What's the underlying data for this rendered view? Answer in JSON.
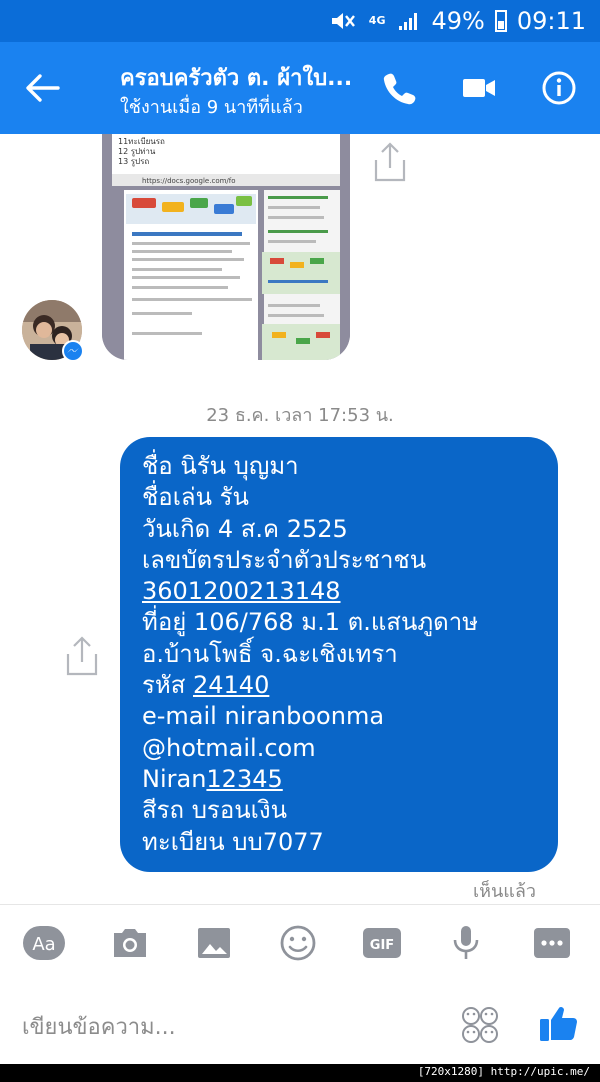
{
  "status": {
    "network": "4G",
    "battery": "49%",
    "time": "09:11"
  },
  "header": {
    "title": "ครอบครัวตัว ต. ผ้าใบ...",
    "subtitle": "ใช้งานเมื่อ 9 นาทีที่แล้ว",
    "icons": [
      "back-arrow-icon",
      "phone-icon",
      "video-camera-icon",
      "info-icon"
    ]
  },
  "shared_image": {
    "lines": [
      "11ทะเบียนรถ",
      "12 รูปท่าน",
      "13 รูปรถ"
    ],
    "url": "https://docs.google.com/fo"
  },
  "timestamp": "23 ธ.ค. เวลา 17:53 น.",
  "message": {
    "line1": "ชื่อ นิรัน บุญมา",
    "line2": "ชื่อเล่น รัน",
    "line3": "วันเกิด 4 ส.ค 2525",
    "line4": "เลขบัตรประจำตัวประชาชน",
    "line5": "3601200213148",
    "line6": "ที่อยู่ 106/768 ม.1 ต.แสนภูดาษ",
    "line7": "อ.บ้านโพธิ์ จ.ฉะเชิงเทรา",
    "line8_prefix": "รหัส ",
    "line8_code": "24140",
    "line9": "e-mail niranboonma",
    "line10": "@hotmail.com",
    "line11_prefix": "Niran",
    "line11_num": "12345",
    "line12": "สีรถ บรอนเงิน",
    "line13": "ทะเบียน บบ7077"
  },
  "seen_label": "เห็นแล้ว",
  "composer": {
    "placeholder": "เขียนข้อความ...",
    "aa_label": "Aa",
    "gif_label": "GIF",
    "tools": [
      "text-style-icon",
      "camera-icon",
      "gallery-icon",
      "emoji-icon",
      "gif-icon",
      "microphone-icon",
      "more-icon"
    ]
  },
  "watermark": "[720x1280] http://upic.me/",
  "colors": {
    "header_blue": "#1a82f0",
    "status_blue": "#0b6dd8",
    "bubble_blue": "#0a66c8",
    "icon_grey": "#8f939b",
    "like_blue": "#1a82f0"
  }
}
